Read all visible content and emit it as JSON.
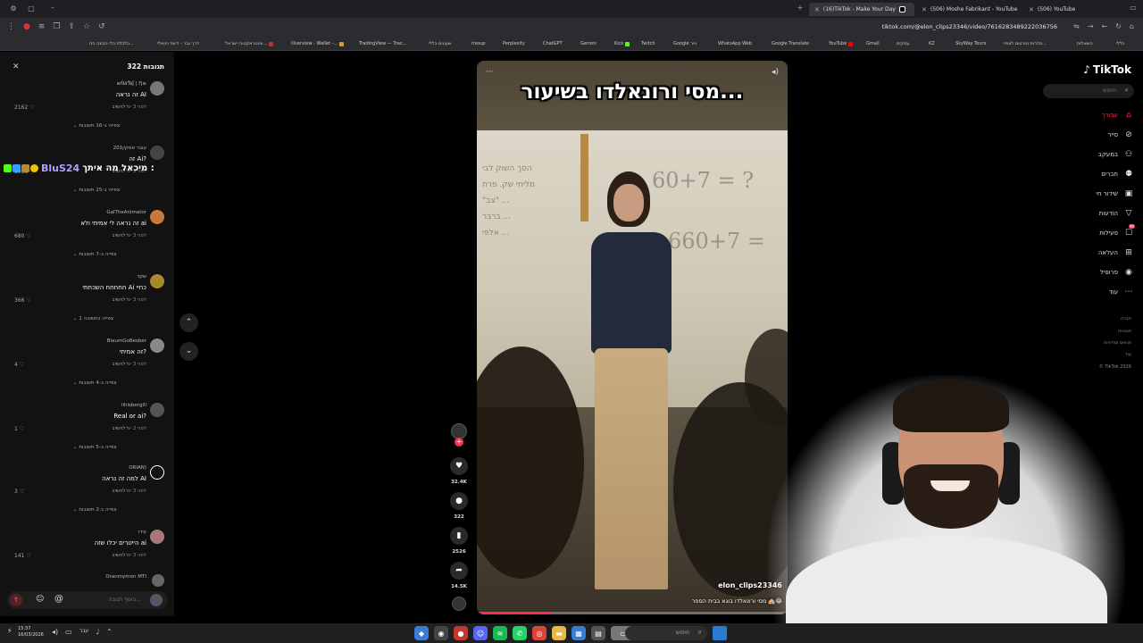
{
  "browser": {
    "tabs": [
      {
        "label": "(16)TikTok - Make Your Day",
        "active": true,
        "color": "#000000"
      },
      {
        "label": "(506) Moshe Fabrikant - YouTube",
        "active": false,
        "color": "#ff0000"
      },
      {
        "label": "(506) YouTube",
        "active": false,
        "color": "#ff0000"
      }
    ],
    "url": "tiktok.com/@elon_clips23346/video/7616283489222036756",
    "bookmarks": [
      "כלכלת כלי הבינה הח...",
      "דרך גבר - דיווח ויזואלי",
      "ווינטראקטיבי ישראל...",
      "Overview - Wallet -...",
      "TradingView — Trac...",
      "שעונים כללי",
      "risoup",
      "Perplexity",
      "ChatGPT",
      "Gemini",
      "Kick",
      "Twitch",
      "Google נייר",
      "WhatsApp Web",
      "Google Translate",
      "YouTube",
      "Gmail",
      "עסקים",
      "KZ",
      "SkyWay Tours",
      "סדרות וסרטים לצפיי...",
      "השאלות",
      "כללי"
    ]
  },
  "comments_panel": {
    "title": "תגובות 322",
    "reply_label": "להשיב",
    "items": [
      {
        "user": "≡ŇäŤäĴ | Ŋ≡",
        "text": "זה נראה AI",
        "time": "לפני 3 ימ'",
        "likes": "2162",
        "view_replies": "צפייה ב-16 תשובות"
      },
      {
        "user": "201עובר אסקין",
        "text": "זה Ai?",
        "time": "לפני 3 ימ'",
        "likes": "1058",
        "view_replies": "צפייה ב-25 תשובות"
      },
      {
        "user": "GalTheAnimator",
        "text": "זה נראה לי אמיתי ולא ai",
        "time": "לפני 3 ימ'",
        "likes": "680",
        "view_replies": "צפייה ב-7 תשובות"
      },
      {
        "user": "שקד",
        "text": "חחחחח השכחתי Ai כחיי",
        "time": "לפני 3 ימ'",
        "likes": "366",
        "view_replies": "צפייה בתשובה 1"
      },
      {
        "user": "BlaumGoBesber",
        "text": "זה אמיתי?",
        "time": "לפני 3 ימ'",
        "likes": "4",
        "view_replies": "צפייה ב-4 תשובות"
      },
      {
        "user": "lihisbergill",
        "text": "Real or ai?",
        "time": "לפני 2 ימ'",
        "likes": "1",
        "view_replies": "צפייה ב-5 תשובות"
      },
      {
        "user": "ORIAN)",
        "text": "למה זה נראה AI",
        "time": "לפני 3 ימ'",
        "likes": "3",
        "view_replies": "צפייה ב-2 תשובות"
      },
      {
        "user": "עידו",
        "text": "הייטרים יכלו שזה ai",
        "time": "לפני 3 ימ'",
        "likes": "141",
        "view_replies": ""
      }
    ],
    "last_user": "Oranmymon MTI",
    "composer_placeholder": "הוסף תגובה..."
  },
  "stream_overlay": {
    "username": "BluS24",
    "message": "מיכאל מה איתך :"
  },
  "video": {
    "caption": "מסי ורונאלדו בשיעור...",
    "board_eq_1": "60+7 = ?",
    "board_eq_2": "660+7 =",
    "author": "elon_clips23346",
    "description": "מסי ורונאלדו בוגא בבית הספר 🏫😂",
    "progress": 0.24,
    "likes": "32.4K",
    "comments": "322",
    "saves": "2526",
    "shares": "14.5K"
  },
  "tiktok_nav": {
    "brand": "TikTok",
    "search_placeholder": "חיפוש",
    "items": [
      {
        "label": "עבורך",
        "icon": "home-icon",
        "active": true
      },
      {
        "label": "סייר",
        "icon": "compass-icon",
        "active": false
      },
      {
        "label": "במעקב",
        "icon": "following-icon",
        "active": false
      },
      {
        "label": "חברים",
        "icon": "friends-icon",
        "active": false
      },
      {
        "label": "שידור חי",
        "icon": "live-icon",
        "active": false
      },
      {
        "label": "הודעות",
        "icon": "messages-icon",
        "active": false
      },
      {
        "label": "פעילות",
        "icon": "activity-icon",
        "active": false,
        "badge": "96"
      },
      {
        "label": "העלאה",
        "icon": "upload-icon",
        "active": false
      },
      {
        "label": "פרופיל",
        "icon": "profile-icon",
        "active": false
      },
      {
        "label": "עוד",
        "icon": "more-icon",
        "active": false
      }
    ],
    "footer": [
      "חברה",
      "תוכניות",
      "תנאים ומדיניות",
      "עוד",
      "© TikTok 2026"
    ]
  },
  "taskbar": {
    "time": "15:37",
    "date": "16/03/2026",
    "search_label": "חיפוש",
    "lang": "עבר"
  },
  "colors": {
    "accent": "#fe2c55",
    "overlay_name": "#b39dff"
  }
}
